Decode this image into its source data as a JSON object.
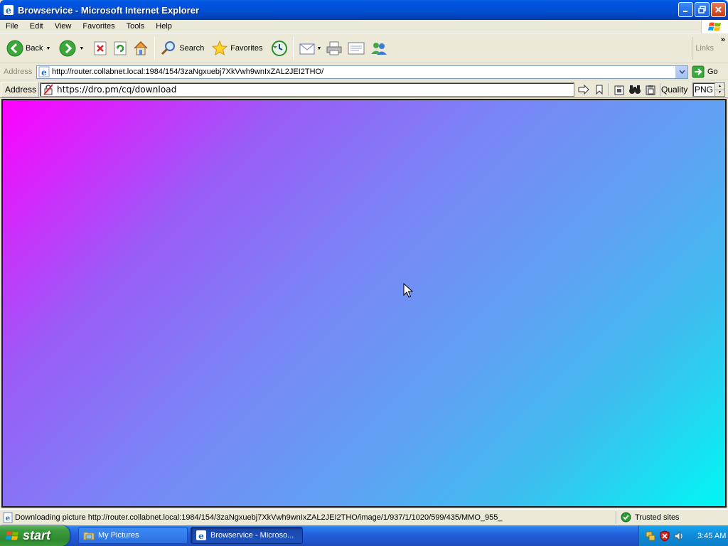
{
  "window": {
    "title": "Browservice - Microsoft Internet Explorer"
  },
  "menu": {
    "items": [
      "File",
      "Edit",
      "View",
      "Favorites",
      "Tools",
      "Help"
    ]
  },
  "toolbar": {
    "back_label": "Back",
    "search_label": "Search",
    "favorites_label": "Favorites",
    "links_label": "Links",
    "icons": [
      "back-icon",
      "forward-icon",
      "stop-icon",
      "refresh-icon",
      "home-icon",
      "search-icon",
      "favorites-icon",
      "history-icon",
      "mail-icon",
      "print-icon",
      "edit-icon",
      "messenger-icon"
    ]
  },
  "addressbar": {
    "label": "Address",
    "url": "http://router.collabnet.local:1984/154/3zaNgxuebj7XkVwh9wnIxZAL2JEI2THO/",
    "go_label": "Go"
  },
  "browservice": {
    "address_label": "Address",
    "url": "https://dro.pm/cq/download",
    "quality_label": "Quality",
    "quality_value": "PNG",
    "icons": [
      "go-arrow-icon",
      "bookmark-icon",
      "clipboard-icon",
      "find-icon",
      "paste-icon"
    ]
  },
  "viewport": {
    "gradient_colors": [
      "#ff00ff",
      "#9b5bf7",
      "#7a85f6",
      "#5fa2f3",
      "#3fbcf0",
      "#00f7f2"
    ]
  },
  "statusbar": {
    "text": "Downloading picture http://router.collabnet.local:1984/154/3zaNgxuebj7XkVwh9wnIxZAL2JEI2THO/image/1/937/1/1020/599/435/MMO_955_",
    "zone_label": "Trusted sites"
  },
  "taskbar": {
    "start_label": "start",
    "tasks": [
      {
        "label": "My Pictures",
        "active": false
      },
      {
        "label": "Browservice - Microso...",
        "active": true
      }
    ],
    "clock": "3:45 AM"
  }
}
